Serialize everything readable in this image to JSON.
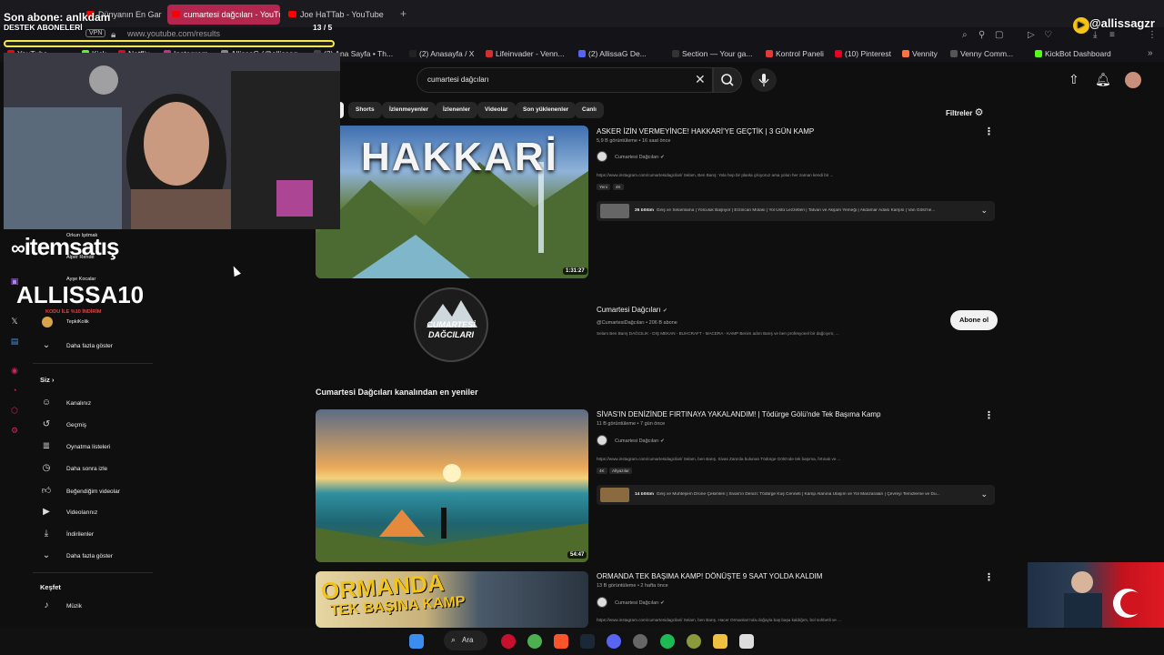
{
  "browser": {
    "tabs": [
      {
        "label": "Dünyanın En Garip ve En G"
      },
      {
        "label": "cumartesi dağcıları - YouTu"
      },
      {
        "label": "Joe HaTTab - YouTube"
      }
    ],
    "new_tab": "+",
    "vpn_label": "VPN",
    "url": "www.youtube.com/results",
    "bookmarks": [
      {
        "label": "YouTube",
        "color": "#ff0000"
      },
      {
        "label": "Kick",
        "color": "#53fc18"
      },
      {
        "label": "Netflix",
        "color": "#e50914"
      },
      {
        "label": "Instagram",
        "color": "#c13584"
      },
      {
        "label": "AllissaG (@allissag",
        "color": "#888888"
      },
      {
        "label": "(2) Ana Sayfa • Th...",
        "color": "#444444"
      },
      {
        "label": "(2) Anasayfa / X",
        "color": "#222222"
      },
      {
        "label": "Lifeinvader - Venn...",
        "color": "#d32f2f"
      },
      {
        "label": "(2) AllissaG De...",
        "color": "#5865f2"
      },
      {
        "label": "Section — Your ga...",
        "color": "#333333"
      },
      {
        "label": "Kontrol Paneli",
        "color": "#e53935"
      },
      {
        "label": "(10) Pinterest",
        "color": "#e60023"
      },
      {
        "label": "Vennity",
        "color": "#ff7043"
      },
      {
        "label": "Venny Comm...",
        "color": "#555555"
      },
      {
        "label": "KickBot Dashboard",
        "color": "#53fc18"
      }
    ]
  },
  "youtube": {
    "search_query": "cumartesi dağcıları",
    "chips": [
      "Shorts",
      "İzlenmeyenler",
      "İzlenenler",
      "Videolar",
      "Son yüklenenler",
      "Canlı"
    ],
    "filters_label": "Filtreler",
    "results": [
      {
        "title": "ASKER İZİN VERMEYİNCE! HAKKARİ'YE GEÇTİK | 3 GÜN KAMP",
        "meta": "5,9 B görüntüleme • 16 saat önce",
        "channel": "Cumartesi Dağcıları",
        "desc": "https://www.instagram.com/cumartesidagcilari/ Selam, Ben Barış: Yola hep bir planla çıkıyoruz ama yolun her zaman kendi bir ...",
        "badges": [
          "Yeni",
          "4K"
        ],
        "chapter_count": "26 bölüm",
        "chapters": "Giriş ve Selamlama | Yolculuk Başlıyor | Erzincan Molası | Yol Üstü Lezzetleri | Tatvan ve Akşam Yemeği | Akdamar Adası Karşısı | Van Gölü'ne...",
        "duration": "1:31:27",
        "thumb_text": "HAKKARİ"
      },
      {
        "title": "SİVAS'IN DENİZİNDE FIRTINAYA YAKALANDIM! | Tödürge Gölü'nde Tek Başıma Kamp",
        "meta": "11 B görüntüleme • 7 gün önce",
        "channel": "Cumartesi Dağcıları",
        "desc": "https://www.instagram.com/cumartesidagcilari/ Selam, ben Barış. Sivas Zara'da bulunan Tödürge Gölü'nde tek başıma, fırtınalı ve ...",
        "badges": [
          "4K",
          "Altyazılar"
        ],
        "chapter_count": "14 bölüm",
        "chapters": "Giriş ve Muhteşem Drone Çekimleri | Sivas'ın Denizi: Tödürge Kuş Cenneti | Kamp Alanına Ulaşım ve Yol Manzaraları | Çevreyi Temizleme ve Du...",
        "duration": "54:47"
      },
      {
        "title": "ORMANDA TEK BAŞIMA KAMP! DÖNÜŞTE 9 SAAT YOLDA KALDIM",
        "meta": "13 B görüntüleme • 2 hafta önce",
        "channel": "Cumartesi Dağcıları",
        "desc": "https://www.instagram.com/cumartesidagcilari/ Selam, ben Barış. Hacer Ormanları'nda doğayla baş başa kaldığım, bol sohbetli ve ...",
        "thumb_line1": "ORMANDA",
        "thumb_line2": "TEK BAŞINA KAMP"
      }
    ],
    "channel_card": {
      "name": "Cumartesi Dağcıları",
      "handle": "@CumartesiDağcıları • 206 B abone",
      "desc": "Selam Ben Barış DAĞCILIK - DIŞ MEKAN - BUHCRAFT - MACERA - KAMP Benim adım Barış ve ben profesyonel bir dağcıyım, ...",
      "logo_line1": "CUMARTESİ",
      "logo_line2": "DAĞCILARI",
      "subscribe_label": "Abone ol"
    },
    "section_title": "Cumartesi Dağcıları kanalından en yeniler",
    "sidebar": {
      "subs": [
        {
          "label": "Orkun Işıtmak"
        },
        {
          "label": "Alper Rende"
        },
        {
          "label": "Ayşe Kocalar"
        },
        {
          "label": "TepkiKolik"
        }
      ],
      "show_more": "Daha fazla göster",
      "you_heading": "Siz",
      "you_items": [
        {
          "label": "Kanalınız",
          "icon": "channel-icon"
        },
        {
          "label": "Geçmiş",
          "icon": "history-icon"
        },
        {
          "label": "Oynatma listeleri",
          "icon": "playlist-icon"
        },
        {
          "label": "Daha sonra izle",
          "icon": "clock-icon"
        },
        {
          "label": "Beğendiğim videolar",
          "icon": "like-icon"
        },
        {
          "label": "Videolarınız",
          "icon": "video-icon"
        },
        {
          "label": "İndirilenler",
          "icon": "download-icon"
        },
        {
          "label": "Daha fazla göster",
          "icon": "chevron-down-icon"
        }
      ],
      "explore_heading": "Keşfet",
      "explore_items": [
        {
          "label": "Müzik",
          "icon": "music-icon"
        }
      ]
    }
  },
  "overlay": {
    "sub_alert": "Son abone: anlkdam",
    "sub_alert_sub": "DESTEK ABONELERİ",
    "counter": "13 / 5",
    "progress": 0,
    "brand": "itemsatış",
    "promo_code": "ALLISSA10",
    "promo_sub": "KODU İLE %10 İNDİRİM",
    "handle": "@allissagzr"
  },
  "taskbar": {
    "search_label": "Ara"
  }
}
